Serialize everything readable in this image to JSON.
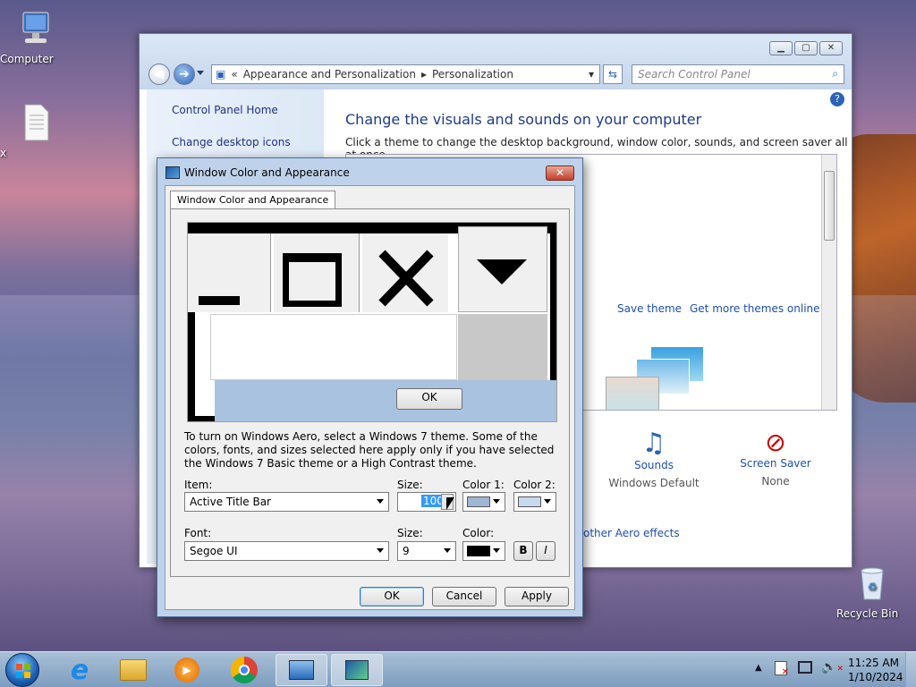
{
  "desktop": {
    "icons": [
      {
        "label": "Computer"
      },
      {
        "label": "x"
      },
      {
        "label": "Recycle Bin"
      }
    ]
  },
  "control_panel": {
    "breadcrumb": [
      "Appearance and Personalization",
      "Personalization"
    ],
    "search_placeholder": "Search Control Panel",
    "left_links": [
      "Control Panel Home",
      "Change desktop icons"
    ],
    "heading": "Change the visuals and sounds on your computer",
    "subtext": "Click a theme to change the desktop background, window color, sounds, and screen saver all at once.",
    "save_theme": "Save theme",
    "get_more_themes": "Get more themes online",
    "sounds": {
      "label": "Sounds",
      "value": "Windows Default"
    },
    "screen_saver": {
      "label": "Screen Saver",
      "value": "None"
    },
    "aero_link": "other Aero effects"
  },
  "dialog": {
    "title": "Window Color and Appearance",
    "tab": "Window Color and Appearance",
    "preview_ok": "OK",
    "info_text": "To turn on Windows Aero, select a Windows 7 theme.  Some of the colors, fonts, and sizes selected here apply only if you have selected the Windows 7 Basic theme or a High Contrast theme.",
    "item_label": "Item:",
    "item_value": "Active Title Bar",
    "size_label": "Size:",
    "size_value": "100",
    "color1_label": "Color 1:",
    "color2_label": "Color 2:",
    "font_label": "Font:",
    "font_value": "Segoe UI",
    "font_size_label": "Size:",
    "font_size_value": "9",
    "font_color_label": "Color:",
    "bold": "B",
    "italic": "I",
    "ok": "OK",
    "cancel": "Cancel",
    "apply": "Apply",
    "colors": {
      "color1": "#9fb6d4",
      "color2": "#c9d9ee",
      "font_color": "#000000"
    }
  },
  "taskbar": {
    "time": "11:25 AM",
    "date": "1/10/2024",
    "icons": [
      "start-orb-icon",
      "internet-explorer-icon",
      "file-explorer-icon",
      "media-player-icon",
      "chrome-icon",
      "control-panel-icon",
      "window-color-icon"
    ]
  }
}
